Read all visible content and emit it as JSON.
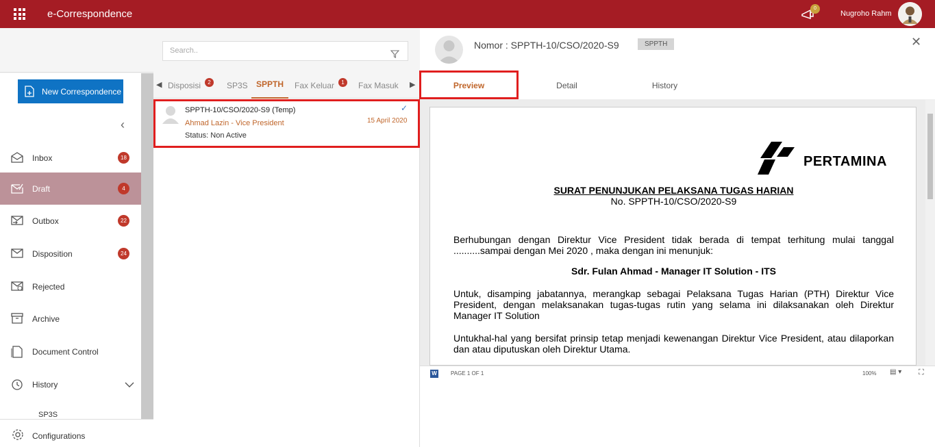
{
  "header": {
    "app_title": "e-Correspondence",
    "notification_count": "0",
    "user_name": "Nugroho Rahm"
  },
  "sidebar": {
    "new_button": "New Correspondence",
    "collapse_glyph": "‹",
    "items": [
      {
        "label": "Inbox",
        "badge": "18",
        "icon": "inbox-icon"
      },
      {
        "label": "Draft",
        "badge": "4",
        "icon": "draft-icon"
      },
      {
        "label": "Outbox",
        "badge": "22",
        "icon": "outbox-icon"
      },
      {
        "label": "Disposition",
        "badge": "24",
        "icon": "disposition-icon"
      },
      {
        "label": "Rejected",
        "badge": "",
        "icon": "rejected-icon"
      },
      {
        "label": "Archive",
        "badge": "",
        "icon": "archive-icon"
      },
      {
        "label": "Document Control",
        "badge": "",
        "icon": "document-control-icon"
      },
      {
        "label": "History",
        "badge": "",
        "icon": "history-icon"
      }
    ],
    "history_sub": "SP3S",
    "config_label": "Configurations",
    "active_color": "#bc9299",
    "badge_color": "#c0392b"
  },
  "list": {
    "search_placeholder": "Search..",
    "tabs": [
      {
        "label": "Disposisi",
        "badge": "2"
      },
      {
        "label": "SP3S",
        "badge": ""
      },
      {
        "label": "SPPTH",
        "badge": ""
      },
      {
        "label": "Fax Keluar",
        "badge": "1"
      },
      {
        "label": "Fax Masuk",
        "badge": ""
      }
    ],
    "active_tab": "SPPTH",
    "card": {
      "title": "SPPTH-10/CSO/2020-S9 (Temp)",
      "sender": "Ahmad Lazin - Vice President",
      "status": "Status: Non Active",
      "date": "15 April 2020"
    }
  },
  "detail": {
    "title": "Nomor : SPPTH-10/CSO/2020-S9",
    "badge": "SPPTH",
    "tabs": [
      "Preview",
      "Detail",
      "History"
    ],
    "active_tab": "Preview",
    "document": {
      "logo_text": "PERTAMINA",
      "title": "SURAT PENUNJUKAN PELAKSANA TUGAS HARIAN",
      "number": "No. SPPTH-10/CSO/2020-S9",
      "para1": "Berhubungan dengan Direktur Vice President tidak berada di tempat terhitung mulai tanggal ..........sampai dengan Mei 2020 , maka dengan ini menunjuk:",
      "appointee": "Sdr. Fulan Ahmad - Manager IT Solution - ITS",
      "para2": "Untuk, disamping jabatannya, merangkap sebagai Pelaksana Tugas Harian (PTH) Direktur Vice President, dengan melaksanakan tugas-tugas rutin yang selama ini dilaksanakan oleh Direktur Manager IT Solution",
      "para3": "Untukhal-hal yang bersifat prinsip tetap menjadi kewenangan Direktur Vice President, atau dilaporkan dan atau diputuskan oleh Direktur Utama."
    },
    "viewer": {
      "page_label": "PAGE 1 OF 1",
      "zoom": "100%"
    },
    "accent_color": "#c0662b",
    "highlight_color": "#e01e1e"
  }
}
